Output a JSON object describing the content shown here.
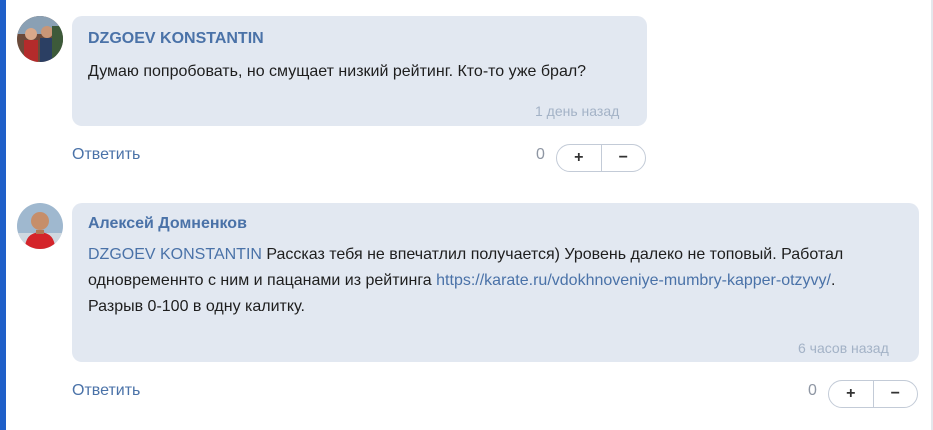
{
  "comments": [
    {
      "author": "DZGOEV KONSTANTIN",
      "text": "Думаю попробовать, но смущает низкий рейтинг. Кто-то уже брал?",
      "time": "1 день назад",
      "reply_label": "Ответить",
      "vote_count": "0",
      "plus_label": "+",
      "minus_label": "−"
    },
    {
      "author": "Алексей Домненков",
      "mention": "DZGOEV KONSTANTIN",
      "text_before_link": " Рассказ тебя не впечатлил получается) Уровень далеко не топовый. Работал одновременнто с ним и пацанами из рейтинга ",
      "link": "https://karate.ru/vdokhnoveniye-mumbry-kapper-otzyvy/",
      "text_after_link": ". Разрыв 0-100 в одну калитку.",
      "time": "6 часов назад",
      "reply_label": "Ответить",
      "vote_count": "0",
      "plus_label": "+",
      "minus_label": "−"
    }
  ]
}
